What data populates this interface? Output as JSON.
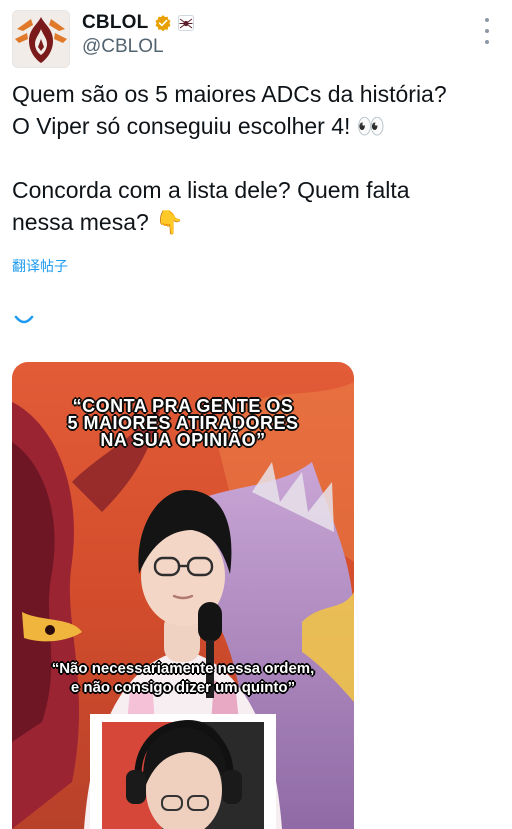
{
  "account": {
    "display_name": "CBLOL",
    "handle": "@CBLOL",
    "verified_icon": "gold-verified-badge-icon",
    "affiliate_icon": "spider-affiliate-icon",
    "avatar_icon": "cblol-logo",
    "colors": {
      "gold": "#e8a100",
      "brand": "#7a1a1a",
      "link": "#1d9bf0"
    }
  },
  "tweet": {
    "text": "Quem são os 5 maiores ADCs da história?\nO Viper só conseguiu escolher 4! 👀\n\nConcorda com a lista dele? Quem falta\nnessa mesa? 👇",
    "translate_label": "翻译帖子",
    "more_icon": "more-vertical-icon"
  },
  "media": {
    "headline_lines": [
      "“CONTA PRA GENTE OS",
      "5 MAIORES ATIRADORES",
      "NA SUA OPINIÃO”"
    ],
    "subtitle_lines": [
      "“Não necessariamente nessa ordem,",
      "e não consigo dizer um quinto”"
    ],
    "colors": {
      "background": "#d6532f",
      "dragon": "#9b2433",
      "mist": "#b28fbd"
    }
  }
}
